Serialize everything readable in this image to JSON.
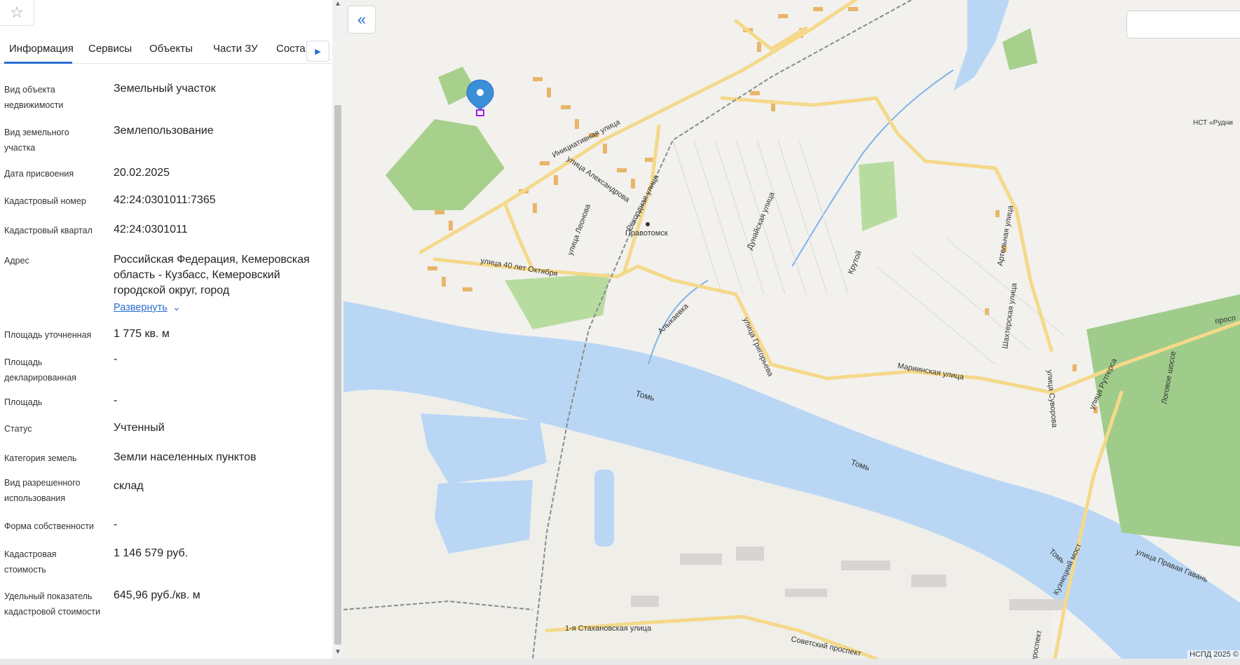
{
  "panel": {
    "tabs": [
      {
        "label": "Информация"
      },
      {
        "label": "Сервисы"
      },
      {
        "label": "Объекты"
      },
      {
        "label": "Части ЗУ"
      },
      {
        "label": "Состав"
      }
    ],
    "rows": [
      {
        "label": "Вид объекта недвижимости",
        "value": "Земельный участок"
      },
      {
        "label": "Вид земельного участка",
        "value": "Землепользование"
      },
      {
        "label": "Дата присвоения",
        "value": "20.02.2025"
      },
      {
        "label": "Кадастровый номер",
        "value": "42:24:0301011:7365"
      },
      {
        "label": "Кадастровый квартал",
        "value": "42:24:0301011"
      },
      {
        "label": "Адрес",
        "value": "Российская Федерация, Кемеровская область - Кузбасс, Кемеровский городской округ, город"
      },
      {
        "label": "Площадь уточненная",
        "value": "1 775 кв. м"
      },
      {
        "label": "Площадь декларированная",
        "value": "-"
      },
      {
        "label": "Площадь",
        "value": "-"
      },
      {
        "label": "Статус",
        "value": "Учтенный"
      },
      {
        "label": "Категория земель",
        "value": "Земли населенных пунктов"
      },
      {
        "label": "Вид разрешенного использования",
        "value": "склад"
      },
      {
        "label": "Форма собственности",
        "value": "-"
      },
      {
        "label": "Кадастровая стоимость",
        "value": "1 146 579 руб."
      },
      {
        "label": "Удельный показатель кадастровой стоимости",
        "value": "645,96 руб./кв. м"
      }
    ],
    "expand_label": "Развернуть"
  },
  "map": {
    "labels": {
      "pravotomsk": "Правотомск",
      "iniciativnaya": "Инициативная улица",
      "aleksandrova": "улица Александрова",
      "rekordnaya": "Рекордная улица",
      "leonova": "улица Леонова",
      "oktyabrya": "улица 40 лет Октября",
      "dunayskaya": "Дунайская улица",
      "alykaevka": "Алыкаевка",
      "grigorieva": "улица Григорьева",
      "krutoy": "Крутой",
      "tom1": "Томь",
      "tom2": "Томь",
      "tom3": "Томь",
      "mariinskaya": "Мариинская улица",
      "artelnaya": "Артельная улица",
      "shakhterskaya": "Шахтерская улица",
      "suvorova": "улица Суворова",
      "ruttgersa": "улица Рутгерса",
      "logovoe": "Логовое шоссе",
      "kuzneckiy": "Кузнецкий мост",
      "pravaya_gavan": "улица Правая Гавань",
      "stakhanovskaya": "1-я Стахановская улица",
      "sovetskiy": "Советский проспект",
      "prospekt_left": "проспект",
      "prosp_right": "просп",
      "nst": "НСТ «Рудни"
    },
    "copyright": "НСПД 2025 ©"
  },
  "colors": {
    "accent": "#2a6ed1",
    "water": "#b9d7f5",
    "park": "#a8d08d",
    "road": "#f5d98a",
    "building": "#e9b56a"
  }
}
